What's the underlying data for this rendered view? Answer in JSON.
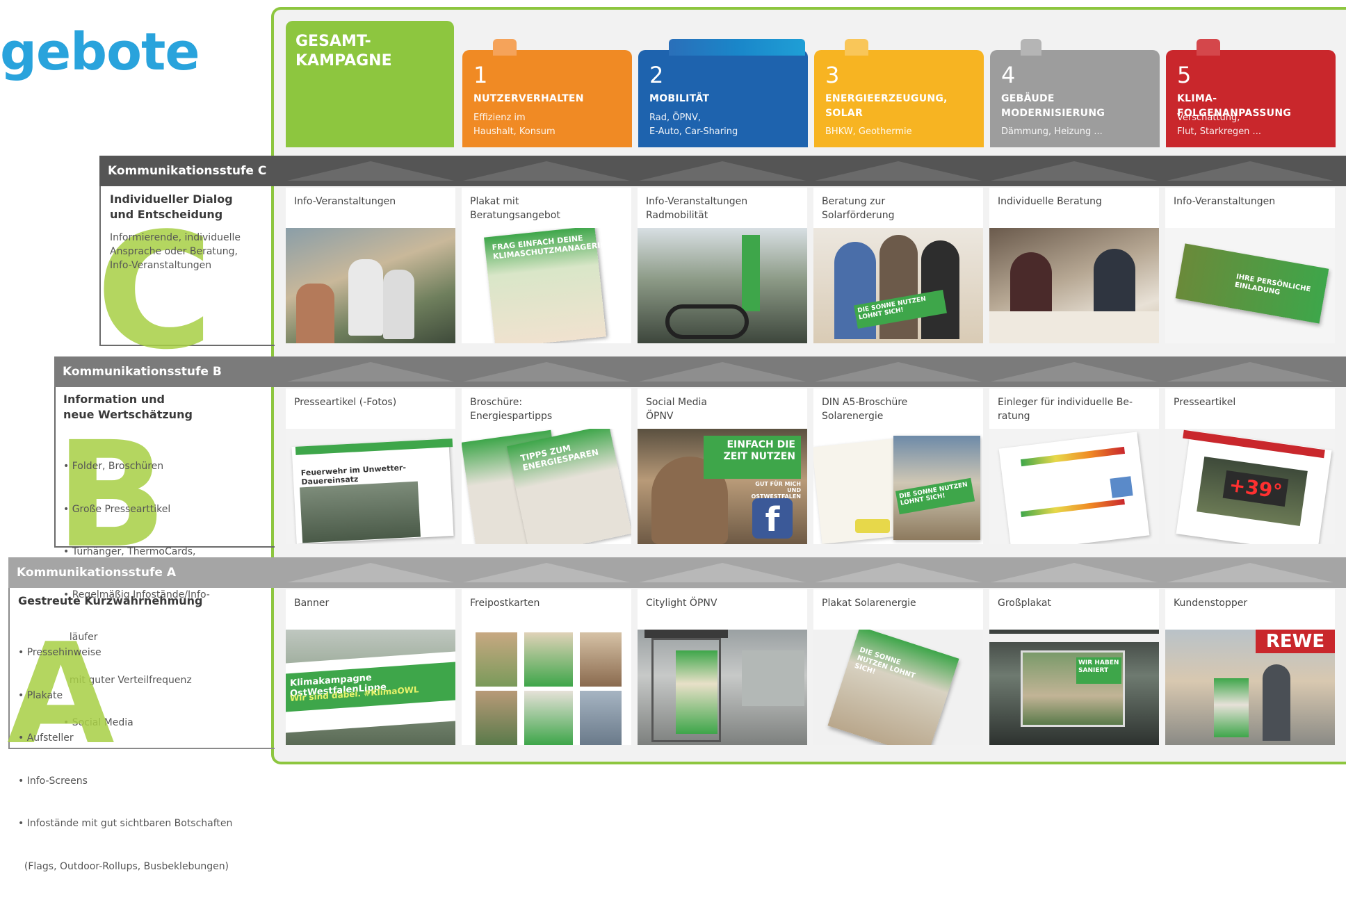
{
  "page_title": "gebote",
  "campaign_tab": {
    "label_line1": "GESAMT-",
    "label_line2": "KAMPAGNE"
  },
  "categories": [
    {
      "num": "1",
      "name_line1": "NUTZERVERHALTEN",
      "name_line2": "",
      "desc_line1": "Effizienz im",
      "desc_line2": "Haushalt, Konsum",
      "color": "#f08a24"
    },
    {
      "num": "2",
      "name_line1": "MOBILITÄT",
      "name_line2": "",
      "desc_line1": "Rad, ÖPNV,",
      "desc_line2": "E-Auto, Car-Sharing",
      "color": "#1e63ae"
    },
    {
      "num": "3",
      "name_line1": "ENERGIEERZEUGUNG,",
      "name_line2": "SOLAR",
      "desc_line1": "BHKW, Geothermie",
      "desc_line2": "",
      "color": "#f7b422"
    },
    {
      "num": "4",
      "name_line1": "GEBÄUDE",
      "name_line2": "MODERNISIERUNG",
      "desc_line1": "Dämmung, Heizung ...",
      "desc_line2": "",
      "color": "#9d9d9d"
    },
    {
      "num": "5",
      "name_line1": "KLIMA-",
      "name_line2": "FOLGENANPASSUNG",
      "desc_line1": "Verschattung,",
      "desc_line2": "Flut, Starkregen ...",
      "color": "#c9272c"
    }
  ],
  "stages": [
    {
      "bar_label": "Kommunikationsstufe C",
      "letter": "C",
      "head_line1": "Individueller Dialog",
      "head_line2": "und Entscheidung",
      "desc": [
        "Informierende, individuelle",
        "Ansprache oder Beratung,",
        "Info-Veranstaltungen"
      ],
      "cells": [
        {
          "line1": "Info-Veranstaltungen",
          "line2": ""
        },
        {
          "line1": "Plakat mit",
          "line2": "Beratungsangebot",
          "overlay": "FRAG EINFACH DEINE KLIMASCHUTZMANAGERIN"
        },
        {
          "line1": "Info-Veranstaltungen",
          "line2": "Radmobilität"
        },
        {
          "line1": "Beratung zur",
          "line2": "Solarförderung",
          "overlay": "DIE SONNE NUTZEN LOHNT SICH!"
        },
        {
          "line1": "Individuelle Beratung",
          "line2": ""
        },
        {
          "line1": "Info-Veranstaltungen",
          "line2": "",
          "overlay": "IHRE PERSÖNLICHE EINLADUNG"
        }
      ]
    },
    {
      "bar_label": "Kommunikationsstufe B",
      "letter": "B",
      "head_line1": "Information und",
      "head_line2": "neue Wertschätzung",
      "desc": [
        "• Folder, Broschüren",
        "• Große Pressearttikel",
        "• Türhänger, ThermoCards,",
        "• Regelmäßig Infostände/Info-",
        "  läufer",
        "  mit guter Verteilfrequenz",
        "• Social Media"
      ],
      "cells": [
        {
          "line1": "Presseartikel (-Fotos)",
          "line2": "",
          "overlay": "Feuerwehr im Unwetter-Dauereinsatz"
        },
        {
          "line1": "Broschüre:",
          "line2": "Energiespartipps",
          "overlay": "TIPPS ZUM ENERGIESPAREN"
        },
        {
          "line1": "Social Media",
          "line2": "ÖPNV",
          "overlay": "EINFACH DIE ZEIT NUTZEN",
          "overlay2": "GUT FÜR MICH UND OSTWESTFALEN"
        },
        {
          "line1": "DIN A5-Broschüre",
          "line2": "Solarenergie",
          "overlay": "DIE SONNE NUTZEN LOHNT SICH!"
        },
        {
          "line1": "Einleger für individuelle Be-",
          "line2": "ratung"
        },
        {
          "line1": "Presseartikel",
          "line2": "",
          "overlay": "+39°"
        }
      ]
    },
    {
      "bar_label": "Kommunikationsstufe A",
      "letter": "A",
      "head_line1": "Gestreute Kurzwahrnehmung",
      "head_line2": "",
      "desc": [
        "• Pressehinweise",
        "• Plakate",
        "• Aufsteller",
        "• Info-Screens",
        "• Infostände mit gut sichtbaren Botschaften",
        "  (Flags, Outdoor-Rollups, Busbeklebungen)"
      ],
      "cells": [
        {
          "line1": "Banner",
          "line2": "",
          "overlay": "Klimakampagne OstWestfalenLippe",
          "overlay2": "Wir sind dabei. #KlimaOWL"
        },
        {
          "line1": "Freipostkarten",
          "line2": ""
        },
        {
          "line1": "Citylight ÖPNV",
          "line2": ""
        },
        {
          "line1": "Plakat Solarenergie",
          "line2": "",
          "overlay": "DIE SONNE NUTZEN LOHNT SICH!"
        },
        {
          "line1": "Großplakat",
          "line2": "",
          "overlay": "WIR HABEN SANIERT"
        },
        {
          "line1": "Kundenstopper",
          "line2": "",
          "overlay": "REWE"
        }
      ]
    }
  ],
  "colors": {
    "green": "#8dc63f",
    "stage_c": "#5a5a5a",
    "stage_b": "#7b7b7b",
    "stage_a": "#a5a5a5",
    "title_blue": "#29a3dc"
  }
}
